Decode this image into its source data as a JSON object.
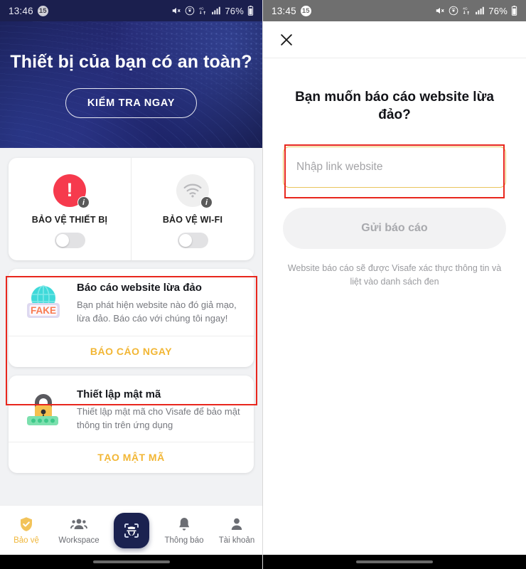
{
  "left": {
    "status_bar": {
      "time": "13:46",
      "badge": "15",
      "battery": "76%",
      "network": "4G",
      "icons": [
        "mute-icon",
        "hotspot-icon",
        "data-transfer-icon",
        "signal-icon",
        "battery-icon"
      ]
    },
    "hero": {
      "title": "Thiết bị của bạn có an toàn?",
      "button": "KIỂM TRA NGAY"
    },
    "protection": [
      {
        "label": "BẢO VỆ THIẾT BỊ",
        "icon": "alert-icon",
        "info": "i",
        "toggle_on": false,
        "icon_color": "#f63a4d"
      },
      {
        "label": "BẢO VỆ WI-FI",
        "icon": "wifi-icon",
        "info": "i",
        "toggle_on": false,
        "icon_color": "#efefef"
      }
    ],
    "features": [
      {
        "icon": "fake-website-icon",
        "title": "Báo cáo website lừa đảo",
        "desc": "Bạn phát hiện website nào đó giả mạo, lừa đảo. Báo cáo với chúng tôi ngay!",
        "action": "BÁO CÁO NGAY"
      },
      {
        "icon": "padlock-icon",
        "title": "Thiết lập mật mã",
        "desc": "Thiết lập mật mã cho Visafe để bảo mật thông tin trên ứng dụng",
        "action": "TẠO MẬT MÃ"
      }
    ],
    "nav": [
      {
        "label": "Bảo vệ",
        "icon": "shield-check-icon",
        "active": true
      },
      {
        "label": "Workspace",
        "icon": "people-group-icon",
        "active": false
      },
      {
        "label": "",
        "icon": "visafe-scan-fab-icon",
        "active": false
      },
      {
        "label": "Thông báo",
        "icon": "bell-icon",
        "active": false
      },
      {
        "label": "Tài khoản",
        "icon": "person-icon",
        "active": false
      }
    ]
  },
  "right": {
    "status_bar": {
      "time": "13:45",
      "badge": "15",
      "battery": "76%",
      "network": "4G"
    },
    "close_icon": "close-icon",
    "title": "Bạn muốn báo cáo website lừa đảo?",
    "input_placeholder": "Nhập link website",
    "input_value": "",
    "submit_label": "Gửi báo cáo",
    "note": "Website báo cáo sẽ được Visafe xác thực thông tin và liệt vào danh sách đen"
  },
  "colors": {
    "accent": "#f2b634",
    "danger": "#f63a4d",
    "navy": "#1b2250",
    "annotation": "#e8261d"
  }
}
